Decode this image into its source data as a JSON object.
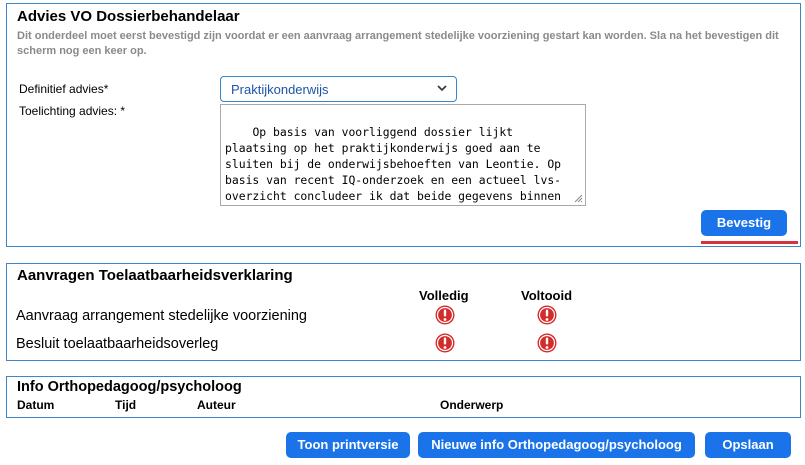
{
  "advies": {
    "title": "Advies VO Dossierbehandelaar",
    "note": "Dit onderdeel moet eerst bevestigd zijn voordat er een aanvraag arrangement stedelijke voorziening gestart kan worden. Sla na het bevestigen dit scherm nog een keer op.",
    "definitief_label": "Definitief advies*",
    "definitief_value": "Praktijkonderwijs",
    "toelichting_label": "Toelichting advies: *",
    "toelichting_text": "Op basis van voorliggend dossier lijkt plaatsing op het praktijkonderwijs goed aan te sluiten bij de onderwijsbehoeften van Leontie. Op basis van recent IQ-onderzoek en een actueel lvs-overzicht concludeer ik dat beide gegevens binnen de TLV-criteria van praktijkonderwijs vallen.",
    "confirm_label": "Bevestig"
  },
  "aanvragen": {
    "title": "Aanvragen Toelaatbaarheidsverklaring",
    "columns": [
      "Volledig",
      "Voltooid"
    ],
    "rows": [
      {
        "label": "Aanvraag arrangement stedelijke voorziening",
        "volledig": "alert-icon",
        "voltooid": "alert-icon"
      },
      {
        "label": "Besluit toelaatbaarheidsoverleg",
        "volledig": "alert-icon",
        "voltooid": "alert-icon"
      }
    ],
    "status_color": "#d42b2b"
  },
  "info": {
    "title": "Info Orthopedagoog/psycholoog",
    "columns": [
      "Datum",
      "Tijd",
      "Auteur",
      "Onderwerp"
    ]
  },
  "footer": {
    "print_label": "Toon printversie",
    "new_info_label": "Nieuwe info Orthopedagoog/psycholoog",
    "save_label": "Opslaan"
  },
  "colors": {
    "accent": "#1a73e8",
    "panel_border": "#3a86c8",
    "underline": "#d9323f"
  }
}
